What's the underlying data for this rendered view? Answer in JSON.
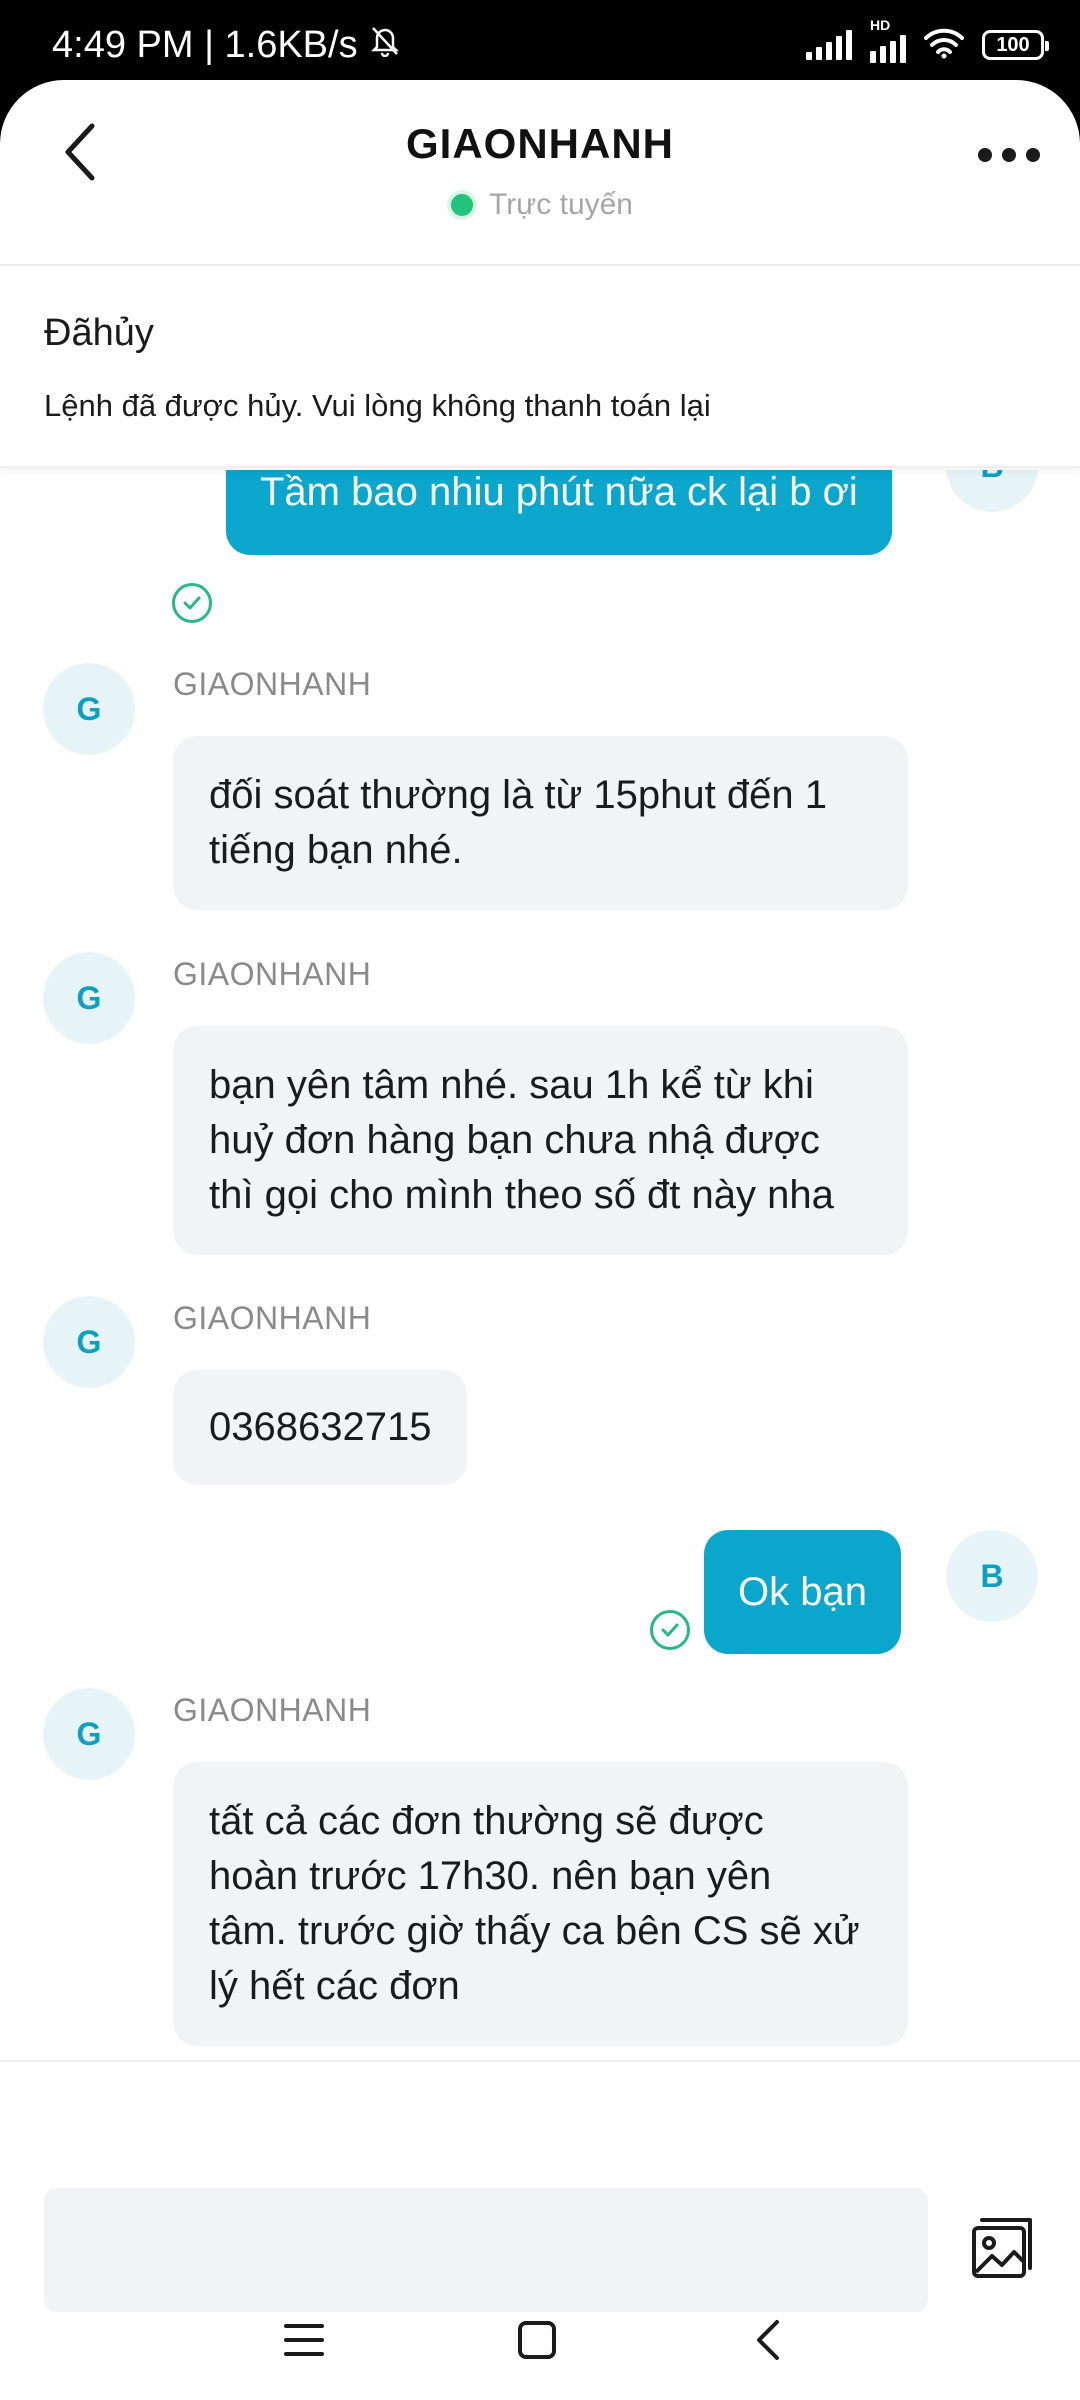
{
  "status_bar": {
    "time_speed": "4:49 PM | 1.6KB/s",
    "hd_label": "HD",
    "battery": "100"
  },
  "header": {
    "title": "GIAONHANH",
    "status": "Trực tuyến"
  },
  "notice": {
    "title": "Đãhủy",
    "text": "Lệnh đã được hủy. Vui lòng không thanh toán lại"
  },
  "messages": [
    {
      "from": "me",
      "avatar": "B",
      "text": "Tầm bao nhiu phút nữa ck lại b ơi"
    },
    {
      "from": "other",
      "avatar": "G",
      "sender": "GIAONHANH",
      "lines": [
        "đối soát thường là từ 15phut đến 1",
        "tiếng bạn nhé."
      ]
    },
    {
      "from": "other",
      "avatar": "G",
      "sender": "GIAONHANH",
      "lines": [
        "bạn yên tâm nhé. sau 1h kể từ khi",
        "huỷ đơn hàng bạn chưa nhậ được",
        "thì gọi cho mình theo số đt này nha"
      ]
    },
    {
      "from": "other",
      "avatar": "G",
      "sender": "GIAONHANH",
      "lines": [
        "0368632715"
      ]
    },
    {
      "from": "me",
      "avatar": "B",
      "text": "Ok bạn"
    },
    {
      "from": "other",
      "avatar": "G",
      "sender": "GIAONHANH",
      "lines": [
        "tất cả các đơn thường sẽ được",
        "hoàn trước 17h30. nên bạn yên",
        "tâm. trước giờ thấy ca bên CS sẽ xử",
        "lý hết các đơn"
      ]
    }
  ],
  "input": {
    "value": "",
    "placeholder": ""
  },
  "icons": {
    "back": "chevron-left-icon",
    "more": "more-horizontal-icon",
    "image": "image-gallery-icon",
    "read": "check-circle-icon",
    "nav_menu": "menu-icon",
    "nav_home": "square-icon",
    "nav_back": "chevron-left-icon"
  },
  "colors": {
    "accent": "#0aa6cc",
    "online": "#22c37a",
    "incoming_bubble": "#f2f3f5",
    "read_check": "#26b886"
  }
}
